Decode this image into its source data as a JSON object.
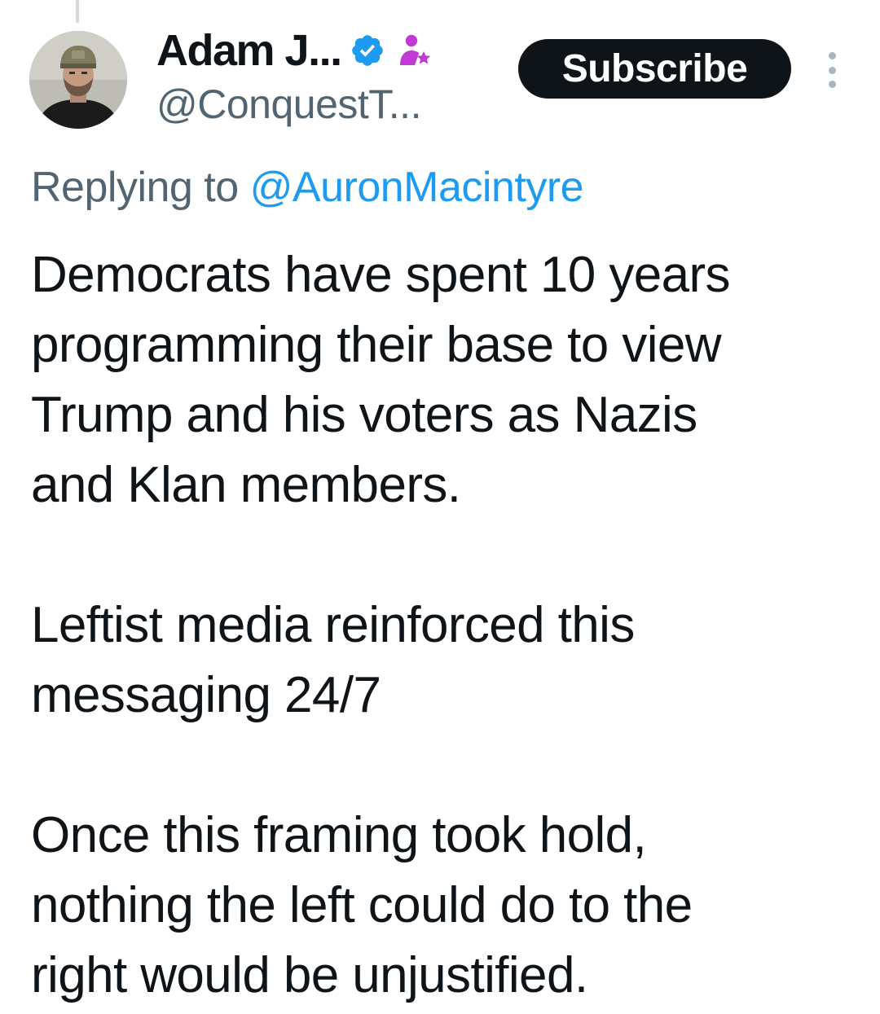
{
  "author": {
    "display_name": "Adam J...",
    "handle": "@ConquestT...",
    "verified_icon": "verified-badge-icon",
    "affiliate_icon": "person-star-icon",
    "avatar": "user-avatar-photo"
  },
  "actions": {
    "subscribe_label": "Subscribe",
    "more_icon": "more-vertical-icon"
  },
  "reply": {
    "prefix": "Replying to",
    "mention": "@AuronMacintyre"
  },
  "tweet": {
    "paragraphs": [
      {
        "lines": [
          "Democrats have spent 10 years",
          "programming their base to view",
          "Trump and his voters as Nazis",
          "and Klan members."
        ]
      },
      {
        "lines": [
          "Leftist media reinforced this",
          "messaging 24/7"
        ]
      },
      {
        "lines": [
          "Once this framing took hold,",
          "nothing the left could do to the",
          "right would be unjustified."
        ]
      }
    ]
  },
  "colors": {
    "text_primary": "#0f1419",
    "text_secondary": "#536471",
    "link": "#1d9bf0",
    "verified": "#1d9bf0",
    "affiliate": "#c13ad6",
    "button_bg": "#0f1419"
  }
}
